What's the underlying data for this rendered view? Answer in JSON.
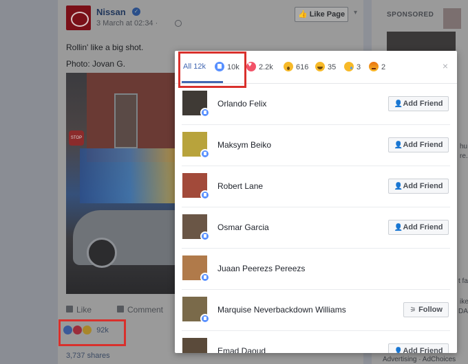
{
  "post": {
    "page_name": "Nissan",
    "timestamp": "3 March at 02:34 ·",
    "like_page_label": "Like Page",
    "text_line1": "Rollin' like a big shot.",
    "text_line2": "Photo: Jovan G.",
    "like_action": "Like",
    "comment_action": "Comment",
    "reactions_total": "92k",
    "shares": "3,737 shares"
  },
  "sidebar": {
    "sponsored_label": "SPONSORED",
    "snips": [
      "hu",
      "re.",
      "t fa",
      "ike",
      "DAB",
      "Advertising · AdChoices"
    ]
  },
  "modal": {
    "tabs": [
      {
        "label": "All 12k"
      },
      {
        "count": "10k",
        "icon": "like-icon"
      },
      {
        "count": "2.2k",
        "icon": "love-icon"
      },
      {
        "count": "616",
        "icon": "wow-icon"
      },
      {
        "count": "35",
        "icon": "haha-icon"
      },
      {
        "count": "3",
        "icon": "sad-icon"
      },
      {
        "count": "2",
        "icon": "angry-icon"
      }
    ],
    "close_symbol": "×",
    "people": [
      {
        "name": "Orlando Felix",
        "button": "Add Friend",
        "avatar_color": "#3f3a35"
      },
      {
        "name": "Maksym Beiko",
        "button": "Add Friend",
        "avatar_color": "#b8a33c"
      },
      {
        "name": "Robert Lane",
        "button": "Add Friend",
        "avatar_color": "#a24a3a"
      },
      {
        "name": "Osmar Garcia",
        "button": "Add Friend",
        "avatar_color": "#6a5646"
      },
      {
        "name": "Juaan Peerezs Pereezs",
        "button": "",
        "avatar_color": "#b07a4a"
      },
      {
        "name": "Marquise Neverbackdown Williams",
        "button": "Follow",
        "avatar_color": "#7a6a4a"
      },
      {
        "name": "Emad Daoud",
        "button": "Add Friend",
        "avatar_color": "#5a4a3a"
      }
    ]
  },
  "colors": {
    "accent": "#4267b2",
    "highlight": "#d9302c",
    "like_blue": "#5890ff"
  }
}
